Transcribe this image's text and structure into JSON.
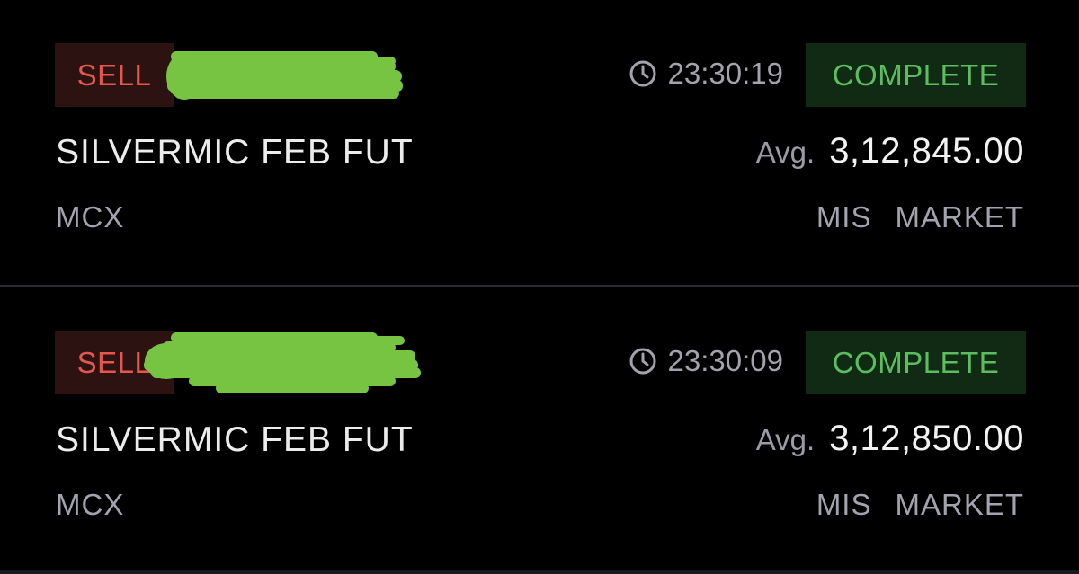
{
  "orders": [
    {
      "side": "SELL",
      "time": "23:30:19",
      "status": "COMPLETE",
      "instrument": "SILVERMIC FEB FUT",
      "avg_label": "Avg.",
      "avg_price": "3,12,845.00",
      "exchange": "MCX",
      "product": "MIS",
      "order_type": "MARKET",
      "icon": "clock-icon"
    },
    {
      "side": "SELL",
      "time": "23:30:09",
      "status": "COMPLETE",
      "instrument": "SILVERMIC FEB FUT",
      "avg_label": "Avg.",
      "avg_price": "3,12,850.00",
      "exchange": "MCX",
      "product": "MIS",
      "order_type": "MARKET",
      "icon": "clock-icon"
    }
  ],
  "colors": {
    "background": "#000000",
    "sell_text": "#e4574f",
    "sell_bg": "#2c1312",
    "complete_text": "#5bbd60",
    "complete_bg": "#102a14",
    "redaction": "#76c442",
    "muted_text": "#a3a3b0"
  }
}
